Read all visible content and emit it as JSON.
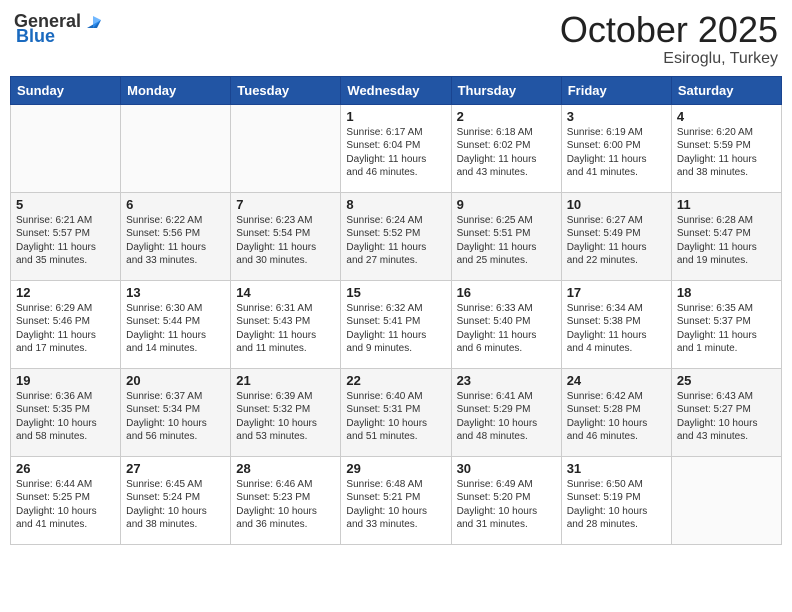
{
  "header": {
    "logo_general": "General",
    "logo_blue": "Blue",
    "month": "October 2025",
    "location": "Esiroglu, Turkey"
  },
  "weekdays": [
    "Sunday",
    "Monday",
    "Tuesday",
    "Wednesday",
    "Thursday",
    "Friday",
    "Saturday"
  ],
  "weeks": [
    [
      {
        "day": "",
        "info": ""
      },
      {
        "day": "",
        "info": ""
      },
      {
        "day": "",
        "info": ""
      },
      {
        "day": "1",
        "info": "Sunrise: 6:17 AM\nSunset: 6:04 PM\nDaylight: 11 hours and 46 minutes."
      },
      {
        "day": "2",
        "info": "Sunrise: 6:18 AM\nSunset: 6:02 PM\nDaylight: 11 hours and 43 minutes."
      },
      {
        "day": "3",
        "info": "Sunrise: 6:19 AM\nSunset: 6:00 PM\nDaylight: 11 hours and 41 minutes."
      },
      {
        "day": "4",
        "info": "Sunrise: 6:20 AM\nSunset: 5:59 PM\nDaylight: 11 hours and 38 minutes."
      }
    ],
    [
      {
        "day": "5",
        "info": "Sunrise: 6:21 AM\nSunset: 5:57 PM\nDaylight: 11 hours and 35 minutes."
      },
      {
        "day": "6",
        "info": "Sunrise: 6:22 AM\nSunset: 5:56 PM\nDaylight: 11 hours and 33 minutes."
      },
      {
        "day": "7",
        "info": "Sunrise: 6:23 AM\nSunset: 5:54 PM\nDaylight: 11 hours and 30 minutes."
      },
      {
        "day": "8",
        "info": "Sunrise: 6:24 AM\nSunset: 5:52 PM\nDaylight: 11 hours and 27 minutes."
      },
      {
        "day": "9",
        "info": "Sunrise: 6:25 AM\nSunset: 5:51 PM\nDaylight: 11 hours and 25 minutes."
      },
      {
        "day": "10",
        "info": "Sunrise: 6:27 AM\nSunset: 5:49 PM\nDaylight: 11 hours and 22 minutes."
      },
      {
        "day": "11",
        "info": "Sunrise: 6:28 AM\nSunset: 5:47 PM\nDaylight: 11 hours and 19 minutes."
      }
    ],
    [
      {
        "day": "12",
        "info": "Sunrise: 6:29 AM\nSunset: 5:46 PM\nDaylight: 11 hours and 17 minutes."
      },
      {
        "day": "13",
        "info": "Sunrise: 6:30 AM\nSunset: 5:44 PM\nDaylight: 11 hours and 14 minutes."
      },
      {
        "day": "14",
        "info": "Sunrise: 6:31 AM\nSunset: 5:43 PM\nDaylight: 11 hours and 11 minutes."
      },
      {
        "day": "15",
        "info": "Sunrise: 6:32 AM\nSunset: 5:41 PM\nDaylight: 11 hours and 9 minutes."
      },
      {
        "day": "16",
        "info": "Sunrise: 6:33 AM\nSunset: 5:40 PM\nDaylight: 11 hours and 6 minutes."
      },
      {
        "day": "17",
        "info": "Sunrise: 6:34 AM\nSunset: 5:38 PM\nDaylight: 11 hours and 4 minutes."
      },
      {
        "day": "18",
        "info": "Sunrise: 6:35 AM\nSunset: 5:37 PM\nDaylight: 11 hours and 1 minute."
      }
    ],
    [
      {
        "day": "19",
        "info": "Sunrise: 6:36 AM\nSunset: 5:35 PM\nDaylight: 10 hours and 58 minutes."
      },
      {
        "day": "20",
        "info": "Sunrise: 6:37 AM\nSunset: 5:34 PM\nDaylight: 10 hours and 56 minutes."
      },
      {
        "day": "21",
        "info": "Sunrise: 6:39 AM\nSunset: 5:32 PM\nDaylight: 10 hours and 53 minutes."
      },
      {
        "day": "22",
        "info": "Sunrise: 6:40 AM\nSunset: 5:31 PM\nDaylight: 10 hours and 51 minutes."
      },
      {
        "day": "23",
        "info": "Sunrise: 6:41 AM\nSunset: 5:29 PM\nDaylight: 10 hours and 48 minutes."
      },
      {
        "day": "24",
        "info": "Sunrise: 6:42 AM\nSunset: 5:28 PM\nDaylight: 10 hours and 46 minutes."
      },
      {
        "day": "25",
        "info": "Sunrise: 6:43 AM\nSunset: 5:27 PM\nDaylight: 10 hours and 43 minutes."
      }
    ],
    [
      {
        "day": "26",
        "info": "Sunrise: 6:44 AM\nSunset: 5:25 PM\nDaylight: 10 hours and 41 minutes."
      },
      {
        "day": "27",
        "info": "Sunrise: 6:45 AM\nSunset: 5:24 PM\nDaylight: 10 hours and 38 minutes."
      },
      {
        "day": "28",
        "info": "Sunrise: 6:46 AM\nSunset: 5:23 PM\nDaylight: 10 hours and 36 minutes."
      },
      {
        "day": "29",
        "info": "Sunrise: 6:48 AM\nSunset: 5:21 PM\nDaylight: 10 hours and 33 minutes."
      },
      {
        "day": "30",
        "info": "Sunrise: 6:49 AM\nSunset: 5:20 PM\nDaylight: 10 hours and 31 minutes."
      },
      {
        "day": "31",
        "info": "Sunrise: 6:50 AM\nSunset: 5:19 PM\nDaylight: 10 hours and 28 minutes."
      },
      {
        "day": "",
        "info": ""
      }
    ]
  ]
}
